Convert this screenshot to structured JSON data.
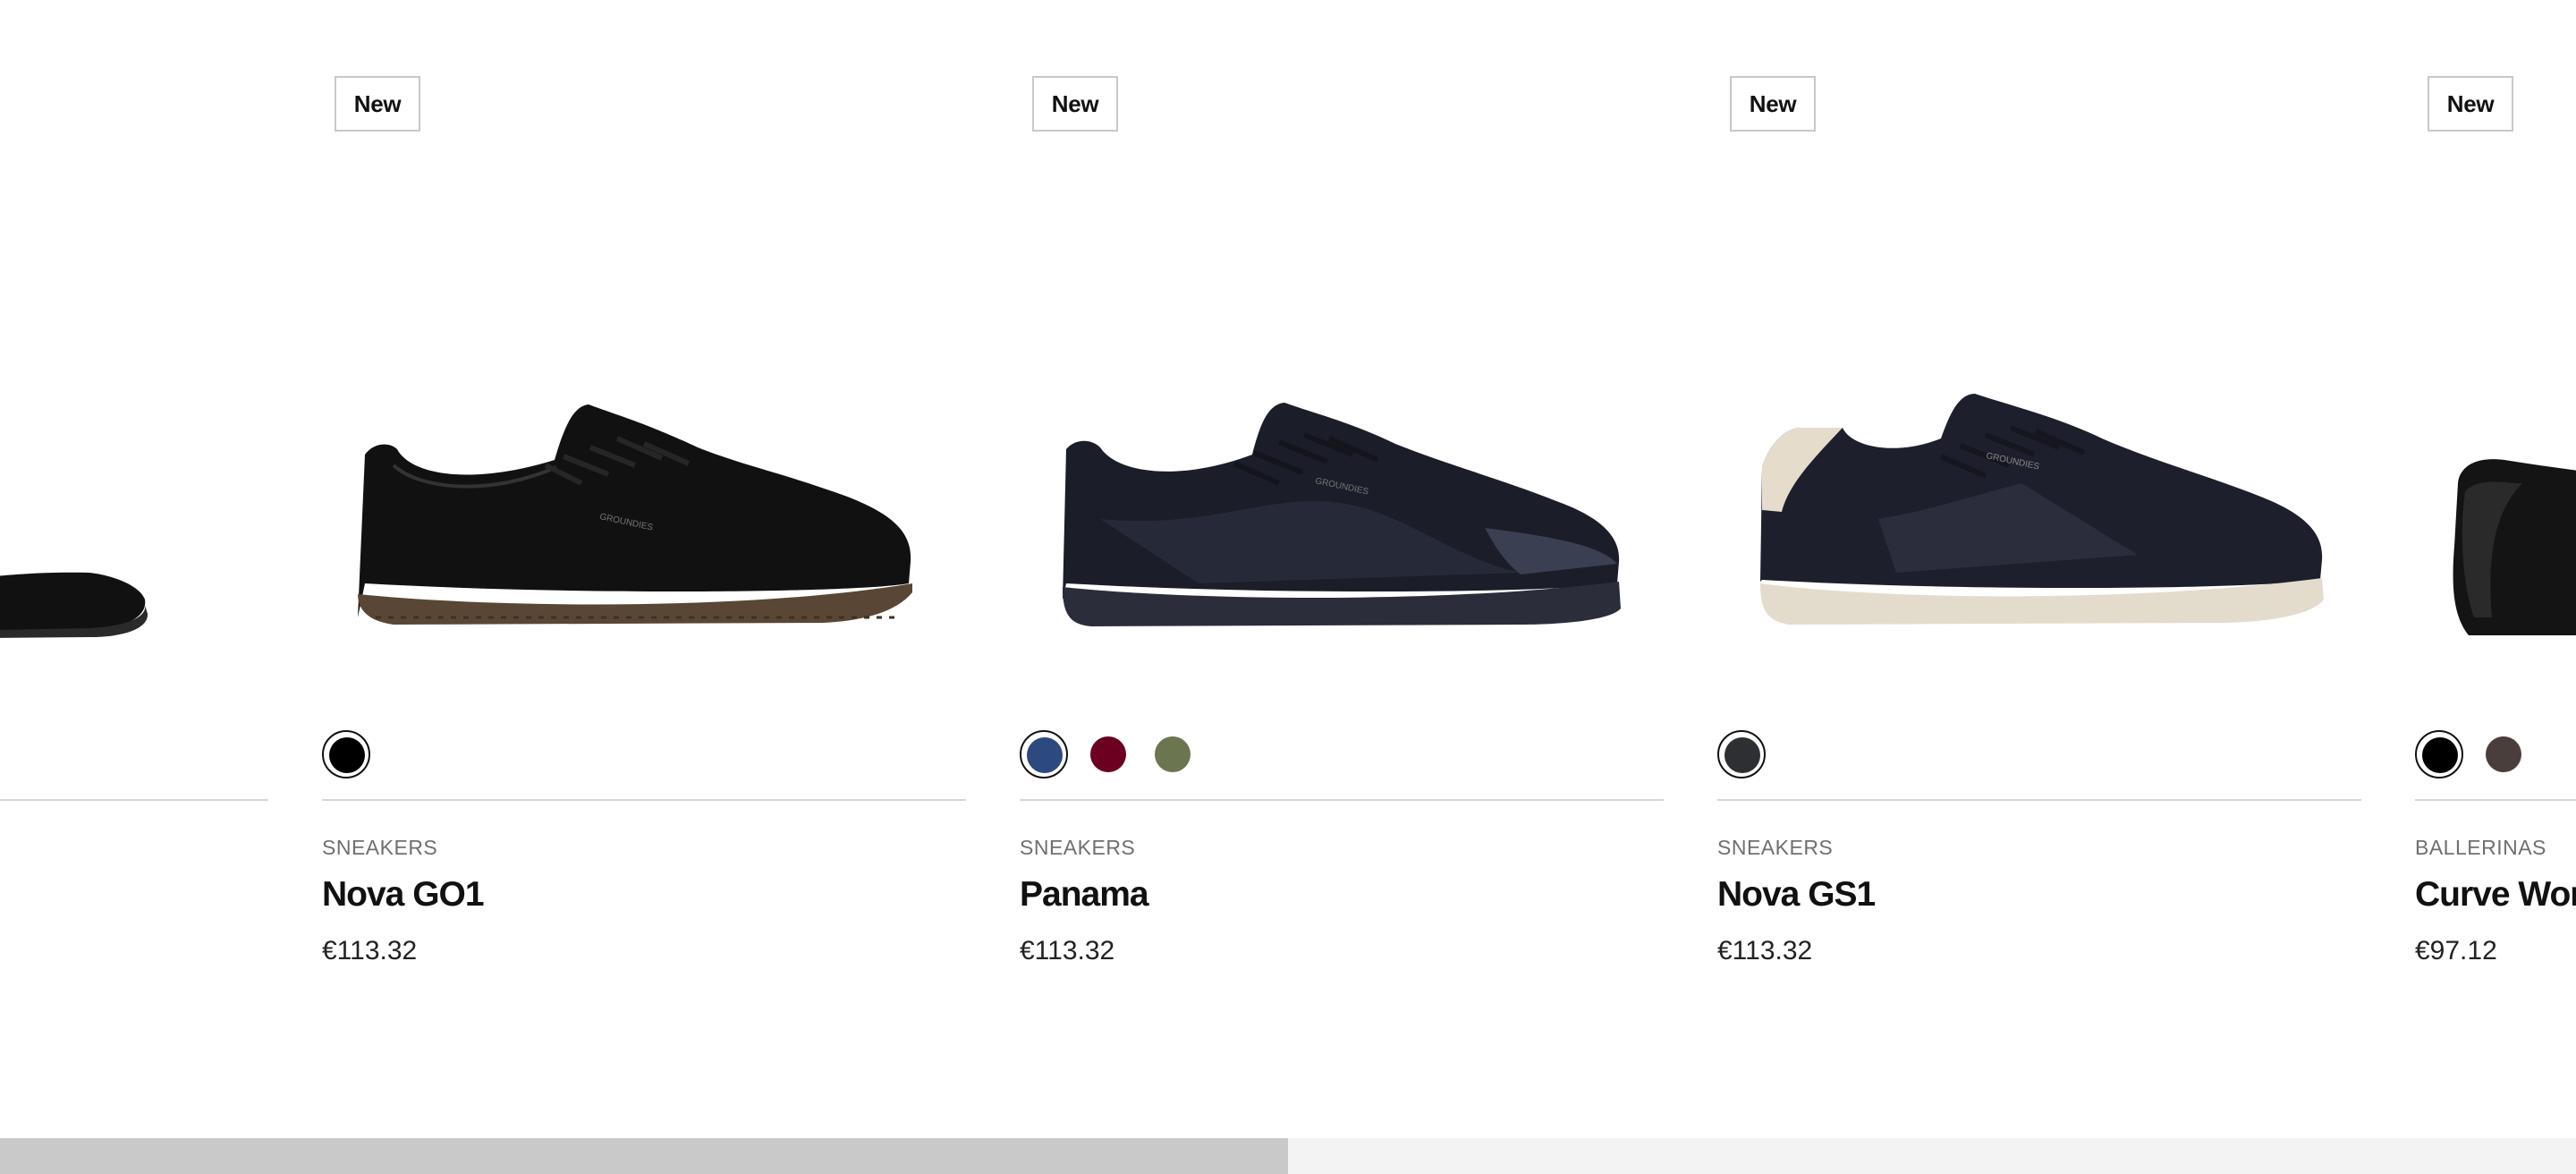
{
  "products": [
    {
      "badge": "New",
      "category": "SNEAKERS",
      "name": "Nova GO1",
      "price": "€113.32",
      "swatches": [
        {
          "color": "#000000",
          "selected": true
        }
      ]
    },
    {
      "badge": "New",
      "category": "SNEAKERS",
      "name": "Panama",
      "price": "€113.32",
      "swatches": [
        {
          "color": "#2c4a7e",
          "selected": true
        },
        {
          "color": "#6b0020",
          "selected": false
        },
        {
          "color": "#6b7550",
          "selected": false
        }
      ]
    },
    {
      "badge": "New",
      "category": "SNEAKERS",
      "name": "Nova GS1",
      "price": "€113.32",
      "swatches": [
        {
          "color": "#2e2f33",
          "selected": true
        }
      ]
    },
    {
      "badge": "New",
      "category": "BALLERINAS",
      "name": "Curve Women",
      "price": "€97.12",
      "swatches": [
        {
          "color": "#000000",
          "selected": true
        },
        {
          "color": "#4a3e3c",
          "selected": false
        }
      ]
    }
  ]
}
